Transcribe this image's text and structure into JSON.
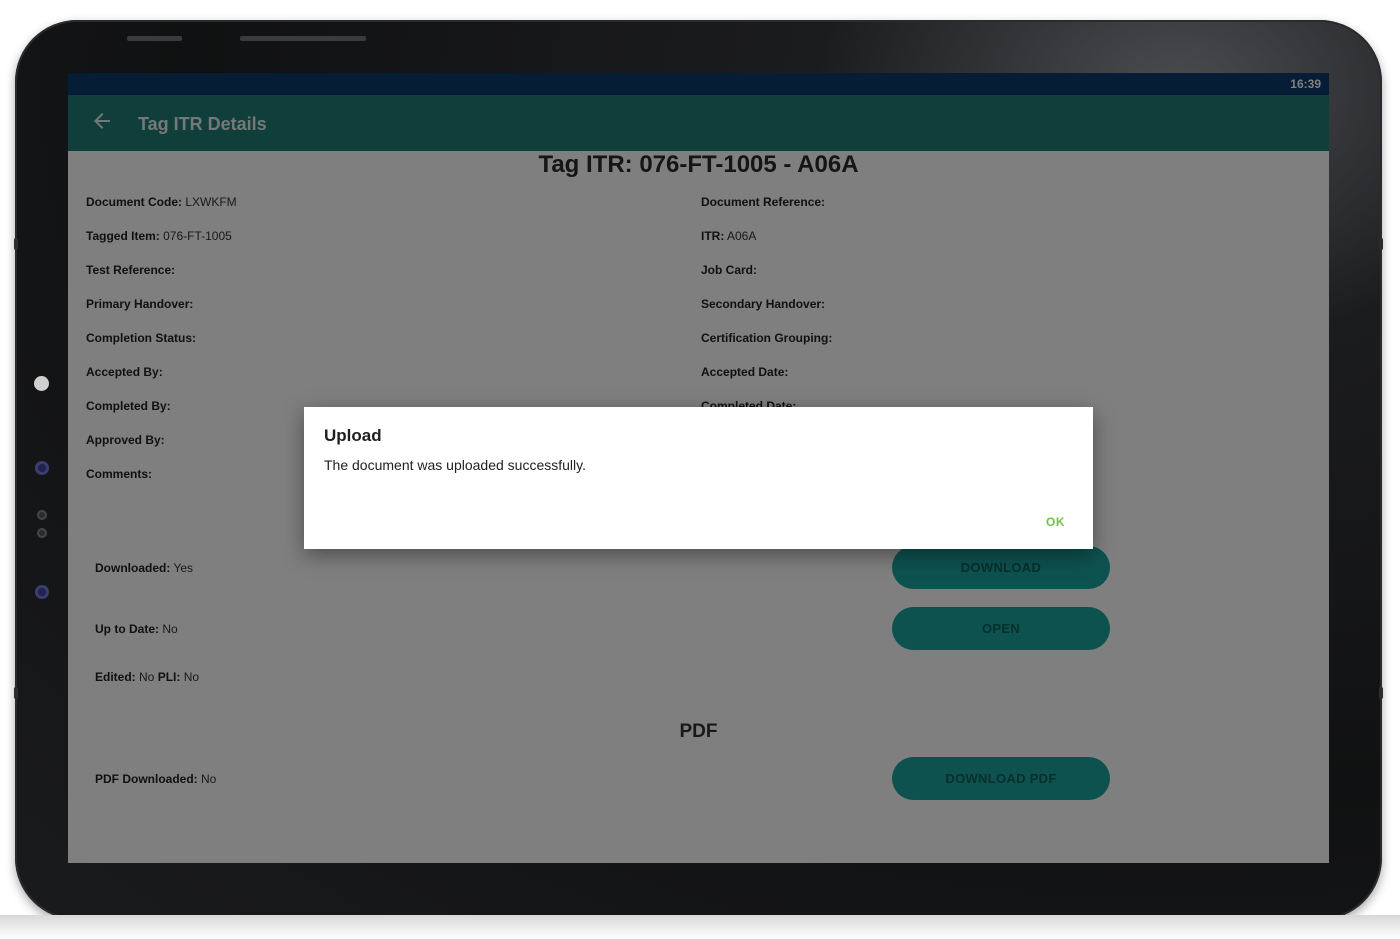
{
  "status_bar": {
    "time": "16:39"
  },
  "app_bar": {
    "title": "Tag ITR Details",
    "back_icon": "arrow-back-icon"
  },
  "page": {
    "heading": "Tag ITR: 076-FT-1005 - A06A",
    "left_fields": [
      {
        "label": "Document Code:",
        "value": "LXWKFM"
      },
      {
        "label": "Tagged Item:",
        "value": "076-FT-1005"
      },
      {
        "label": "Test Reference:",
        "value": ""
      },
      {
        "label": "Primary Handover:",
        "value": ""
      },
      {
        "label": "Completion Status:",
        "value": ""
      },
      {
        "label": "Accepted By:",
        "value": ""
      },
      {
        "label": "Completed By:",
        "value": ""
      },
      {
        "label": "Approved By:",
        "value": ""
      },
      {
        "label": "Comments:",
        "value": ""
      }
    ],
    "right_fields": [
      {
        "label": "Document Reference:",
        "value": ""
      },
      {
        "label": "ITR:",
        "value": "A06A"
      },
      {
        "label": "Job Card:",
        "value": ""
      },
      {
        "label": "Secondary Handover:",
        "value": ""
      },
      {
        "label": "Certification Grouping:",
        "value": ""
      },
      {
        "label": "Accepted Date:",
        "value": ""
      },
      {
        "label": "Completed Date:",
        "value": ""
      }
    ],
    "downloaded": {
      "label": "Downloaded:",
      "value": "Yes"
    },
    "up_to_date": {
      "label": "Up to Date:",
      "value": "No"
    },
    "edited": {
      "label": "Edited:",
      "value": "No",
      "pli_label": "PLI:",
      "pli_value": "No"
    },
    "buttons": {
      "download": "DOWNLOAD",
      "open": "OPEN",
      "download_pdf": "DOWNLOAD PDF"
    },
    "pdf_heading": "PDF",
    "pdf_downloaded": {
      "label": "PDF Downloaded:",
      "value": "No"
    }
  },
  "dialog": {
    "title": "Upload",
    "message": "The document was uploaded successfully.",
    "ok_label": "OK"
  },
  "colors": {
    "status_bar": "#0b3a6b",
    "app_bar": "#1e7c76",
    "button": "#1ca59e",
    "dialog_ok": "#6cc24a"
  }
}
